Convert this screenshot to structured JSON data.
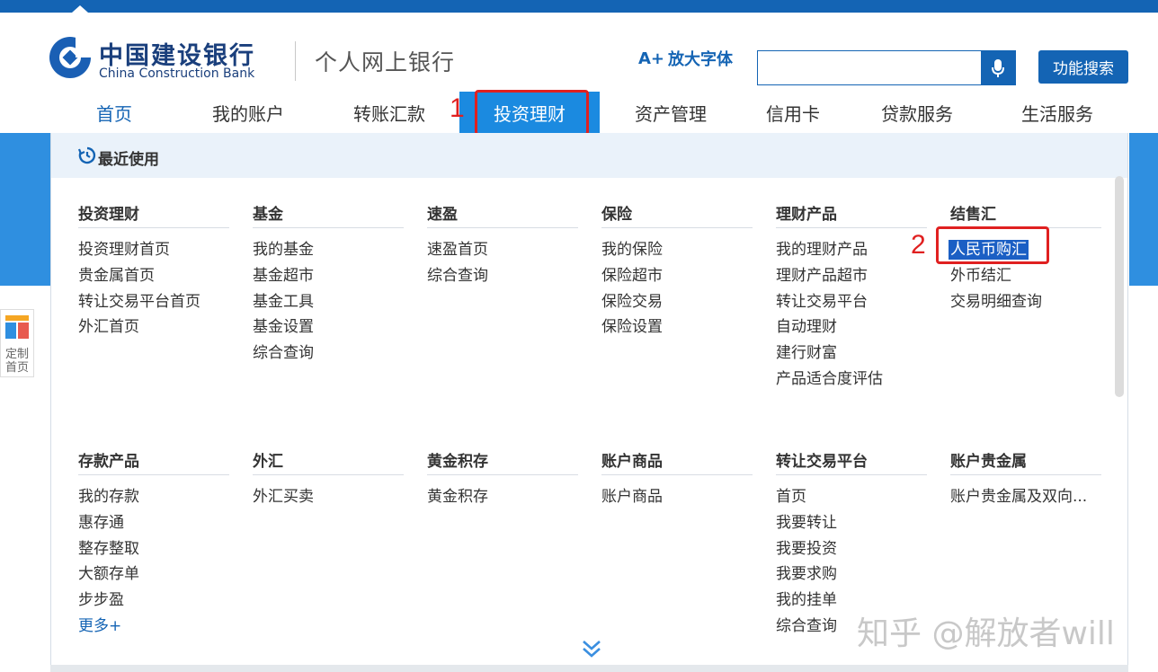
{
  "brand": {
    "name_cn": "中国建设银行",
    "name_en": "China Construction Bank",
    "site_title": "个人网上银行"
  },
  "header": {
    "enlarge_font_label": "放大字体",
    "enlarge_prefix": "A+",
    "search_placeholder": "",
    "function_search_label": "功能搜索"
  },
  "nav": {
    "items": [
      {
        "label": "首页"
      },
      {
        "label": "我的账户"
      },
      {
        "label": "转账汇款"
      },
      {
        "label": "投资理财"
      },
      {
        "label": "资产管理"
      },
      {
        "label": "信用卡"
      },
      {
        "label": "贷款服务"
      },
      {
        "label": "生活服务"
      }
    ],
    "active_index": 3
  },
  "annotations": {
    "step1": "1",
    "step2": "2"
  },
  "side": {
    "custom_home_line1": "定制",
    "custom_home_line2": "首页"
  },
  "menu": {
    "recent_label": "最近使用",
    "row1": [
      {
        "title": "投资理财",
        "links": [
          "投资理财首页",
          "贵金属首页",
          "转让交易平台首页",
          "外汇首页"
        ]
      },
      {
        "title": "基金",
        "links": [
          "我的基金",
          "基金超市",
          "基金工具",
          "基金设置",
          "综合查询"
        ]
      },
      {
        "title": "速盈",
        "links": [
          "速盈首页",
          "综合查询"
        ]
      },
      {
        "title": "保险",
        "links": [
          "我的保险",
          "保险超市",
          "保险交易",
          "保险设置"
        ]
      },
      {
        "title": "理财产品",
        "links": [
          "我的理财产品",
          "理财产品超市",
          "转让交易平台",
          "自动理财",
          "建行财富",
          "产品适合度评估"
        ]
      },
      {
        "title": "结售汇",
        "links": [
          "人民币购汇",
          "外币结汇",
          "交易明细查询"
        ]
      }
    ],
    "row2": [
      {
        "title": "存款产品",
        "links": [
          "我的存款",
          "惠存通",
          "整存整取",
          "大额存单",
          "步步盈"
        ],
        "more": "更多+"
      },
      {
        "title": "外汇",
        "links": [
          "外汇买卖"
        ]
      },
      {
        "title": "黄金积存",
        "links": [
          "黄金积存"
        ]
      },
      {
        "title": "账户商品",
        "links": [
          "账户商品"
        ]
      },
      {
        "title": "转让交易平台",
        "links": [
          "首页",
          "我要转让",
          "我要投资",
          "我要求购",
          "我的挂单",
          "综合查询"
        ]
      },
      {
        "title": "账户贵金属",
        "links": [
          "账户贵金属及双向..."
        ]
      }
    ]
  },
  "watermark": "知乎 @解放者will",
  "colors": {
    "primary": "#1464b4",
    "active_nav": "#1b8ae0",
    "annotation_red": "#e02020",
    "highlight": "#1b5fc4"
  }
}
